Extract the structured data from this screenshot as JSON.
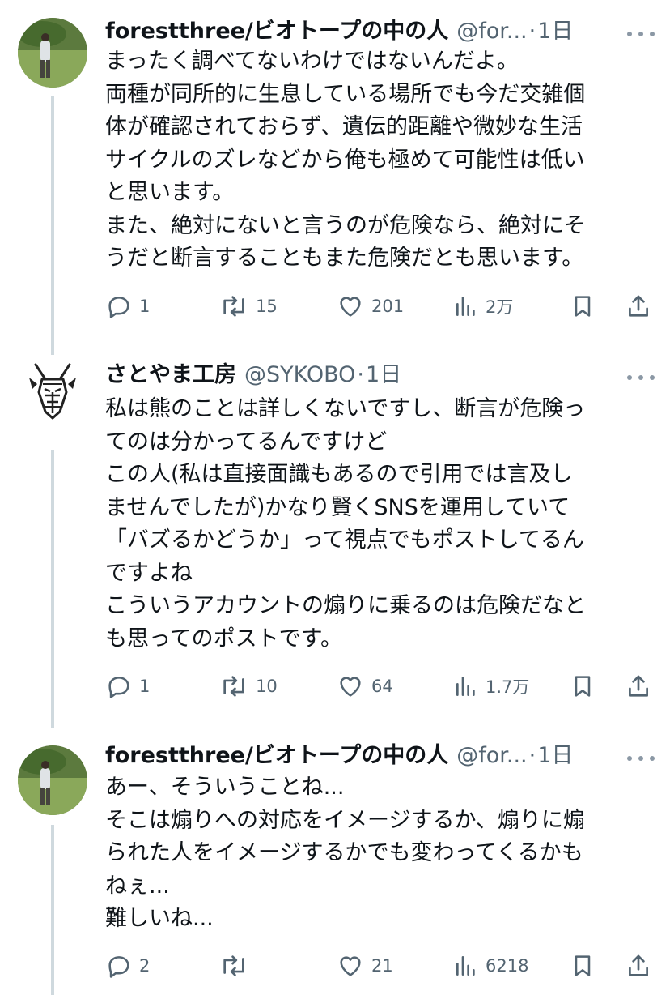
{
  "tweets": [
    {
      "name": "forestthree/ビオトープの中の人",
      "handle": "@for...",
      "dot": "·",
      "time": "1日",
      "lines": [
        "まったく調べてないわけではないんだよ。",
        "両種が同所的に生息している場所でも今だ交雑個",
        "体が確認されておらず、遺伝的距離や微妙な生活",
        "サイクルのズレなどから俺も極めて可能性は低い",
        "と思います。",
        "また、絶対にないと言うのが危険なら、絶対にそ",
        "うだと断言することもまた危険だとも思います。"
      ],
      "reply_count": "1",
      "retweet_count": "15",
      "like_count": "201",
      "view_count": "2万"
    },
    {
      "name": "さとやま工房",
      "handle": "@SYKOBO",
      "dot": "·",
      "time": "1日",
      "lines": [
        "私は熊のことは詳しくないですし、断言が危険っ",
        "てのは分かってるんですけど",
        "この人(私は直接面識もあるので引用では言及し",
        "ませんでしたが)かなり賢くSNSを運用していて",
        "「バズるかどうか」って視点でもポストしてるん",
        "ですよね",
        "こういうアカウントの煽りに乗るのは危険だなと",
        "も思ってのポストです。"
      ],
      "reply_count": "1",
      "retweet_count": "10",
      "like_count": "64",
      "view_count": "1.7万"
    },
    {
      "name": "forestthree/ビオトープの中の人",
      "handle": "@for...",
      "dot": "·",
      "time": "1日",
      "lines": [
        "あー、そういうことね...",
        "そこは煽りへの対応をイメージするか、煽りに煽",
        "られた人をイメージするかでも変わってくるかも",
        "ねぇ...",
        "難しいね..."
      ],
      "reply_count": "2",
      "retweet_count": "",
      "like_count": "21",
      "view_count": "6218"
    }
  ],
  "icons": [
    "reply-icon",
    "retweet-icon",
    "like-icon",
    "views-icon",
    "bookmark-icon",
    "share-icon",
    "more-icon"
  ],
  "colors": {
    "text": "#0f1419",
    "secondary": "#536471",
    "thread_line": "#cfd9de"
  }
}
